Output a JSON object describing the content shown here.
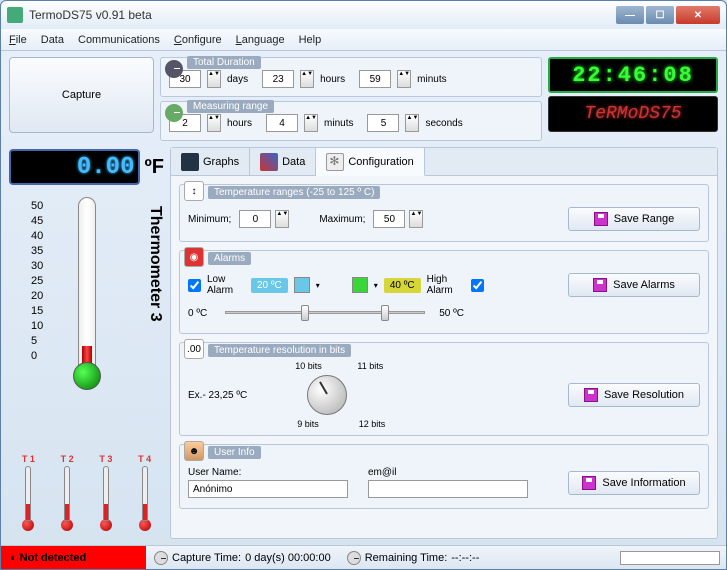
{
  "window": {
    "title": "TermoDS75 v0.91 beta"
  },
  "menu": {
    "file": "File",
    "data": "Data",
    "comm": "Communications",
    "config": "Configure",
    "lang": "Language",
    "help": "Help"
  },
  "capture_btn": "Capture",
  "duration": {
    "total_label": "Total Duration",
    "days": "30",
    "days_lbl": "days",
    "hours": "23",
    "hours_lbl": "hours",
    "minutes": "59",
    "minutes_lbl": "minuts",
    "measuring_label": "Measuring range",
    "m_hours": "2",
    "m_hours_lbl": "hours",
    "m_min": "4",
    "m_min_lbl": "minuts",
    "m_sec": "5",
    "m_sec_lbl": "seconds"
  },
  "clock": "22:46:08",
  "logo": "TeRMoDS75",
  "temp": {
    "value": "0.00",
    "unit": "ºF"
  },
  "thermometer_label": "Thermometer 3",
  "scale": [
    "50",
    "45",
    "40",
    "35",
    "30",
    "25",
    "20",
    "15",
    "10",
    "5",
    "0"
  ],
  "mini": [
    "T 1",
    "T 2",
    "T 3",
    "T 4"
  ],
  "tabs": {
    "graphs": "Graphs",
    "data": "Data",
    "config": "Configuration"
  },
  "ranges": {
    "label": "Temperature ranges (-25 to 125 º C)",
    "min_lbl": "Minimum;",
    "min": "0",
    "max_lbl": "Maximum;",
    "max": "50",
    "save": "Save Range"
  },
  "alarms": {
    "label": "Alarms",
    "low_lbl": "Low Alarm",
    "low_val": "20 ºC",
    "high_lbl": "High Alarm",
    "high_val": "40 ºC",
    "track_low": "0 ºC",
    "track_high": "50 ºC",
    "save": "Save Alarms",
    "colors": {
      "low": "#69c8e8",
      "high": "#39d639"
    }
  },
  "resolution": {
    "label": "Temperature resolution in bits",
    "example": "Ex.- 23,25 ºC",
    "b9": "9 bits",
    "b10": "10 bits",
    "b11": "11 bits",
    "b12": "12 bits",
    "save": "Save Resolution"
  },
  "user": {
    "label": "User Info",
    "name_lbl": "User Name:",
    "name_val": "Anónimo",
    "email_lbl": "em@il",
    "save": "Save Information"
  },
  "status": {
    "detect": "Not detected",
    "capture_lbl": "Capture Time: ",
    "capture_val": "0 day(s) 00:00:00",
    "remain_lbl": "Remaining Time: ",
    "remain_val": "--:--:--"
  }
}
